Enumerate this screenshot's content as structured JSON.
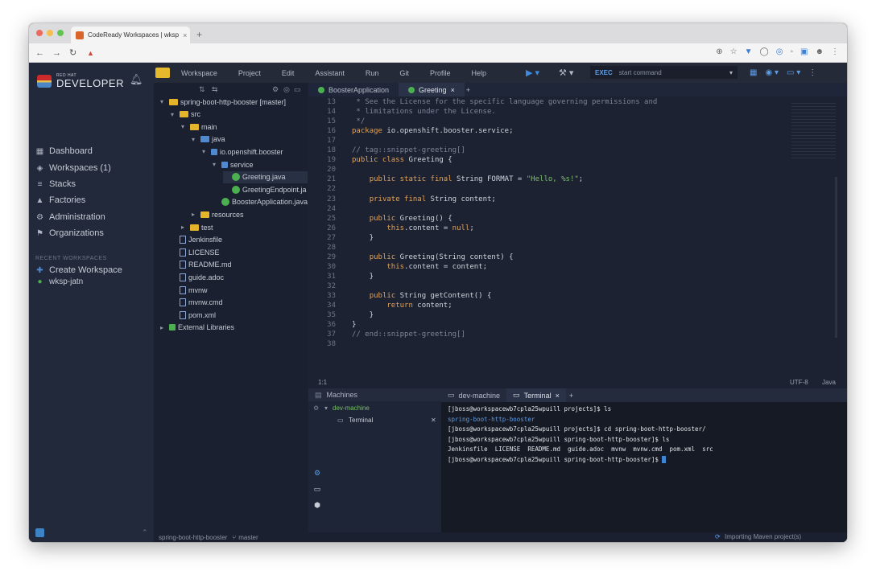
{
  "browser": {
    "tab_title": "CodeReady Workspaces | wksp",
    "tab_close": "×",
    "new_tab": "+",
    "url": "▲"
  },
  "nav": {
    "logo_top": "RED HAT",
    "logo_main": "DEVELOPER",
    "items": [
      {
        "icon": "dashboard-icon",
        "glyph": "▦",
        "label": "Dashboard"
      },
      {
        "icon": "workspaces-icon",
        "glyph": "◈",
        "label": "Workspaces (1)"
      },
      {
        "icon": "stacks-icon",
        "glyph": "≡",
        "label": "Stacks"
      },
      {
        "icon": "factories-icon",
        "glyph": "▲",
        "label": "Factories"
      },
      {
        "icon": "administration-icon",
        "glyph": "⚙",
        "label": "Administration"
      },
      {
        "icon": "organizations-icon",
        "glyph": "⚑",
        "label": "Organizations"
      }
    ],
    "recent_heading": "RECENT WORKSPACES",
    "create_workspace": "Create Workspace",
    "workspace_name": "wksp-jatn"
  },
  "ide": {
    "menu": [
      "Workspace",
      "Project",
      "Edit",
      "Assistant",
      "Run",
      "Git",
      "Profile",
      "Help"
    ],
    "command_prefix": "EXEC",
    "command_placeholder": "start command",
    "tree": [
      {
        "label": "spring-boot-http-booster [master]",
        "type": "project",
        "level": 0,
        "arrow": "▾"
      },
      {
        "label": "src",
        "type": "folder",
        "level": 1,
        "arrow": "▾"
      },
      {
        "label": "main",
        "type": "folder",
        "level": 2,
        "arrow": "▾"
      },
      {
        "label": "java",
        "type": "folder-blue",
        "level": 3,
        "arrow": "▾"
      },
      {
        "label": "io.openshift.booster",
        "type": "package",
        "level": 4,
        "arrow": "▾"
      },
      {
        "label": "service",
        "type": "package",
        "level": 5,
        "arrow": "▾"
      },
      {
        "label": "Greeting.java",
        "type": "java",
        "level": 6,
        "arrow": ""
      },
      {
        "label": "GreetingEndpoint.ja",
        "type": "java",
        "level": 6,
        "arrow": ""
      },
      {
        "label": "BoosterApplication.java",
        "type": "java",
        "level": 5,
        "arrow": ""
      },
      {
        "label": "resources",
        "type": "folder",
        "level": 3,
        "arrow": "▸"
      },
      {
        "label": "test",
        "type": "folder",
        "level": 2,
        "arrow": "▸"
      },
      {
        "label": "Jenkinsfile",
        "type": "file",
        "level": 1,
        "arrow": ""
      },
      {
        "label": "LICENSE",
        "type": "file",
        "level": 1,
        "arrow": ""
      },
      {
        "label": "README.md",
        "type": "file",
        "level": 1,
        "arrow": ""
      },
      {
        "label": "guide.adoc",
        "type": "file",
        "level": 1,
        "arrow": ""
      },
      {
        "label": "mvnw",
        "type": "file",
        "level": 1,
        "arrow": ""
      },
      {
        "label": "mvnw.cmd",
        "type": "file",
        "level": 1,
        "arrow": ""
      },
      {
        "label": "pom.xml",
        "type": "file",
        "level": 1,
        "arrow": ""
      },
      {
        "label": "External Libraries",
        "type": "lib",
        "level": 0,
        "arrow": "▸"
      }
    ],
    "editor_tabs": [
      {
        "label": "BoosterApplication",
        "active": false
      },
      {
        "label": "Greeting",
        "active": true
      }
    ],
    "code": [
      {
        "n": "13",
        "html": "<span class='cm'> * See the License for the specific language governing permissions and</span>"
      },
      {
        "n": "14",
        "html": "<span class='cm'> * limitations under the License.</span>"
      },
      {
        "n": "15",
        "html": "<span class='cm'> */</span>"
      },
      {
        "n": "16",
        "html": "<span class='kw'>package</span> io.openshift.booster.service;"
      },
      {
        "n": "17",
        "html": ""
      },
      {
        "n": "18",
        "html": "<span class='cm'>// tag::snippet-greeting[]</span>"
      },
      {
        "n": "19",
        "html": "<span class='kw'>public class</span> Greeting {"
      },
      {
        "n": "20",
        "html": ""
      },
      {
        "n": "21",
        "html": "    <span class='kw'>public static final</span> String FORMAT = <span class='st'>\"Hello, %s!\"</span>;"
      },
      {
        "n": "22",
        "html": ""
      },
      {
        "n": "23",
        "html": "    <span class='kw'>private final</span> String content;"
      },
      {
        "n": "24",
        "html": ""
      },
      {
        "n": "25",
        "html": "    <span class='kw'>public</span> Greeting() {"
      },
      {
        "n": "26",
        "html": "        <span class='kw'>this</span>.content = <span class='kw'>null</span>;"
      },
      {
        "n": "27",
        "html": "    }"
      },
      {
        "n": "28",
        "html": ""
      },
      {
        "n": "29",
        "html": "    <span class='kw'>public</span> Greeting(String content) {"
      },
      {
        "n": "30",
        "html": "        <span class='kw'>this</span>.content = content;"
      },
      {
        "n": "31",
        "html": "    }"
      },
      {
        "n": "32",
        "html": ""
      },
      {
        "n": "33",
        "html": "    <span class='kw'>public</span> String getContent() {"
      },
      {
        "n": "34",
        "html": "        <span class='kw'>return</span> content;"
      },
      {
        "n": "35",
        "html": "    }"
      },
      {
        "n": "36",
        "html": "}"
      },
      {
        "n": "37",
        "html": "<span class='cm'>// end::snippet-greeting[]</span>"
      },
      {
        "n": "38",
        "html": ""
      }
    ],
    "status_left": "1:1",
    "status_encoding": "UTF-8",
    "status_lang": "Java",
    "machines_title": "Machines",
    "machine_name": "dev-machine",
    "machine_terminal": "Terminal",
    "term_tabs": [
      {
        "label": "dev-machine",
        "active": false
      },
      {
        "label": "Terminal",
        "active": true
      }
    ],
    "terminal_lines": [
      "[jboss@workspacewb7cpla25wpuill projects]$ ls",
      "spring-boot-http-booster",
      "[jboss@workspacewb7cpla25wpuill projects]$ cd spring-boot-http-booster/",
      "[jboss@workspacewb7cpla25wpuill spring-boot-http-booster]$ ls",
      "Jenkinsfile  LICENSE  README.md  guide.adoc  mvnw  mvnw.cmd  pom.xml  src",
      "[jboss@workspacewb7cpla25wpuill spring-boot-http-booster]$ "
    ],
    "footer_project": "spring-boot-http-booster",
    "footer_branch": "master",
    "footer_status": "Importing Maven project(s)",
    "import_progress": 1.0
  },
  "colors": {
    "mac_red": "#ec6a5e",
    "mac_yellow": "#f4bf4f",
    "mac_green": "#61c554"
  }
}
